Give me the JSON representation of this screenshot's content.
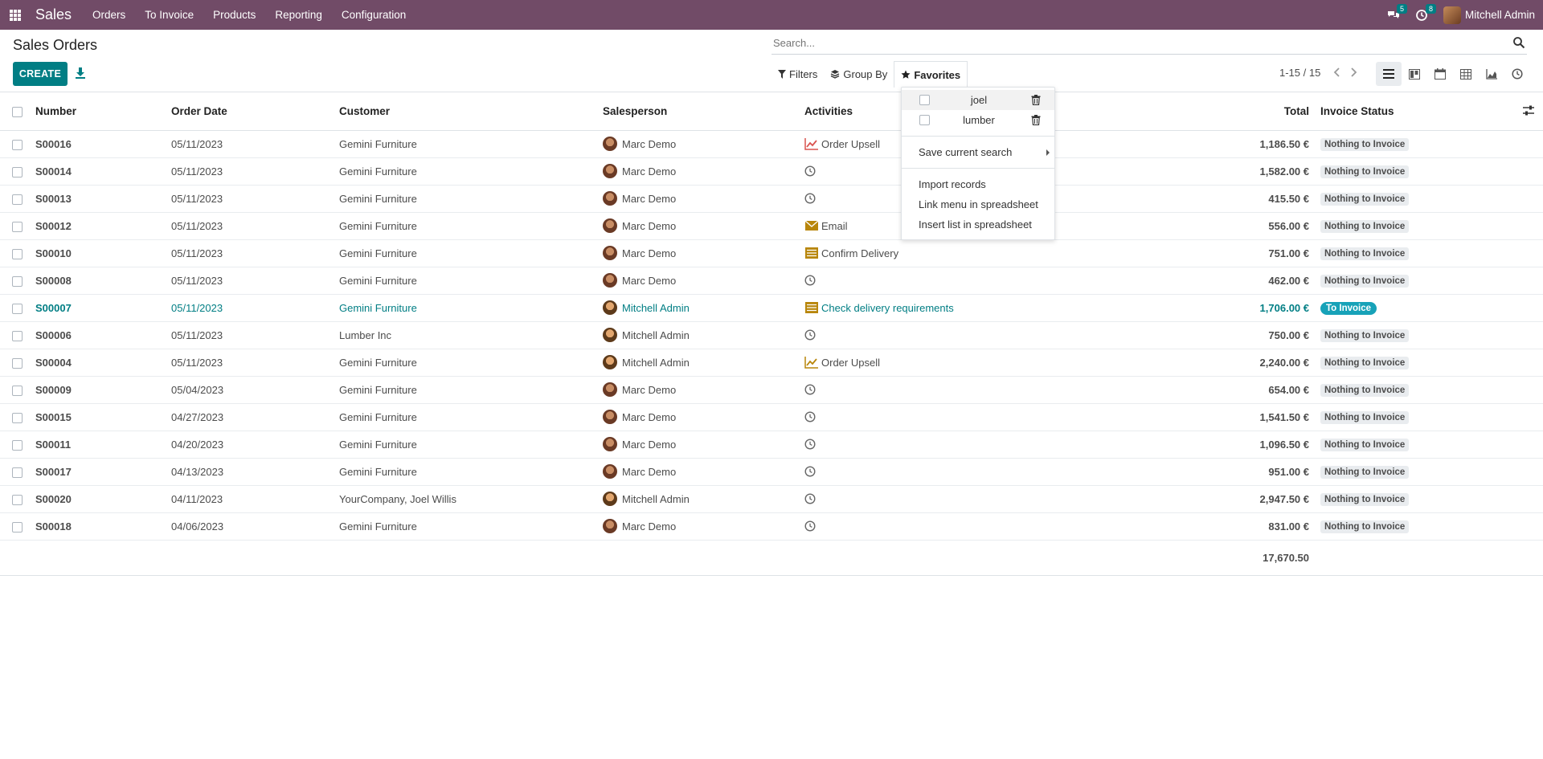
{
  "navbar": {
    "app_name": "Sales",
    "menu": [
      "Orders",
      "To Invoice",
      "Products",
      "Reporting",
      "Configuration"
    ],
    "messages_count": "5",
    "activities_count": "8",
    "user_name": "Mitchell Admin"
  },
  "control": {
    "title": "Sales Orders",
    "create_label": "CREATE",
    "search_placeholder": "Search...",
    "filters_label": "Filters",
    "groupby_label": "Group By",
    "favorites_label": "Favorites",
    "pager": "1-15 / 15"
  },
  "columns": {
    "number": "Number",
    "date": "Order Date",
    "customer": "Customer",
    "salesperson": "Salesperson",
    "activities": "Activities",
    "total": "Total",
    "status": "Invoice Status"
  },
  "rows": [
    {
      "number": "S00016",
      "date": "05/11/2023",
      "customer": "Gemini Furniture",
      "salesperson": "Marc Demo",
      "activity": "Order Upsell",
      "activity_icon": "chart-line-red-icon",
      "total": "1,186.50 €",
      "status": "Nothing to Invoice"
    },
    {
      "number": "S00014",
      "date": "05/11/2023",
      "customer": "Gemini Furniture",
      "salesperson": "Marc Demo",
      "activity": "",
      "activity_icon": "clock-icon",
      "total": "1,582.00 €",
      "status": "Nothing to Invoice"
    },
    {
      "number": "S00013",
      "date": "05/11/2023",
      "customer": "Gemini Furniture",
      "salesperson": "Marc Demo",
      "activity": "",
      "activity_icon": "clock-icon",
      "total": "415.50 €",
      "status": "Nothing to Invoice"
    },
    {
      "number": "S00012",
      "date": "05/11/2023",
      "customer": "Gemini Furniture",
      "salesperson": "Marc Demo",
      "activity": "Email",
      "activity_icon": "envelope-icon",
      "total": "556.00 €",
      "status": "Nothing to Invoice"
    },
    {
      "number": "S00010",
      "date": "05/11/2023",
      "customer": "Gemini Furniture",
      "salesperson": "Marc Demo",
      "activity": "Confirm Delivery",
      "activity_icon": "tasks-icon",
      "total": "751.00 €",
      "status": "Nothing to Invoice"
    },
    {
      "number": "S00008",
      "date": "05/11/2023",
      "customer": "Gemini Furniture",
      "salesperson": "Marc Demo",
      "activity": "",
      "activity_icon": "clock-icon",
      "total": "462.00 €",
      "status": "Nothing to Invoice"
    },
    {
      "number": "S00007",
      "date": "05/11/2023",
      "customer": "Gemini Furniture",
      "salesperson": "Mitchell Admin",
      "activity": "Check delivery requirements",
      "activity_icon": "tasks-icon",
      "total": "1,706.00 €",
      "status": "To Invoice"
    },
    {
      "number": "S00006",
      "date": "05/11/2023",
      "customer": "Lumber Inc",
      "salesperson": "Mitchell Admin",
      "activity": "",
      "activity_icon": "clock-icon",
      "total": "750.00 €",
      "status": "Nothing to Invoice"
    },
    {
      "number": "S00004",
      "date": "05/11/2023",
      "customer": "Gemini Furniture",
      "salesperson": "Mitchell Admin",
      "activity": "Order Upsell",
      "activity_icon": "chart-line-yellow-icon",
      "total": "2,240.00 €",
      "status": "Nothing to Invoice"
    },
    {
      "number": "S00009",
      "date": "05/04/2023",
      "customer": "Gemini Furniture",
      "salesperson": "Marc Demo",
      "activity": "",
      "activity_icon": "clock-icon",
      "total": "654.00 €",
      "status": "Nothing to Invoice"
    },
    {
      "number": "S00015",
      "date": "04/27/2023",
      "customer": "Gemini Furniture",
      "salesperson": "Marc Demo",
      "activity": "",
      "activity_icon": "clock-icon",
      "total": "1,541.50 €",
      "status": "Nothing to Invoice"
    },
    {
      "number": "S00011",
      "date": "04/20/2023",
      "customer": "Gemini Furniture",
      "salesperson": "Marc Demo",
      "activity": "",
      "activity_icon": "clock-icon",
      "total": "1,096.50 €",
      "status": "Nothing to Invoice"
    },
    {
      "number": "S00017",
      "date": "04/13/2023",
      "customer": "Gemini Furniture",
      "salesperson": "Marc Demo",
      "activity": "",
      "activity_icon": "clock-icon",
      "total": "951.00 €",
      "status": "Nothing to Invoice"
    },
    {
      "number": "S00020",
      "date": "04/11/2023",
      "customer": "YourCompany, Joel Willis",
      "salesperson": "Mitchell Admin",
      "activity": "",
      "activity_icon": "clock-icon",
      "total": "2,947.50 €",
      "status": "Nothing to Invoice"
    },
    {
      "number": "S00018",
      "date": "04/06/2023",
      "customer": "Gemini Furniture",
      "salesperson": "Marc Demo",
      "activity": "",
      "activity_icon": "clock-icon",
      "total": "831.00 €",
      "status": "Nothing to Invoice"
    }
  ],
  "sum_total": "17,670.50",
  "favorites_menu": {
    "favorites": [
      "joel",
      "lumber"
    ],
    "save_search": "Save current search",
    "actions": [
      "Import records",
      "Link menu in spreadsheet",
      "Insert list in spreadsheet"
    ]
  },
  "colors": {
    "navbar": "#714b67",
    "primary": "#017e84",
    "to_invoice_badge": "#17a2b8"
  }
}
